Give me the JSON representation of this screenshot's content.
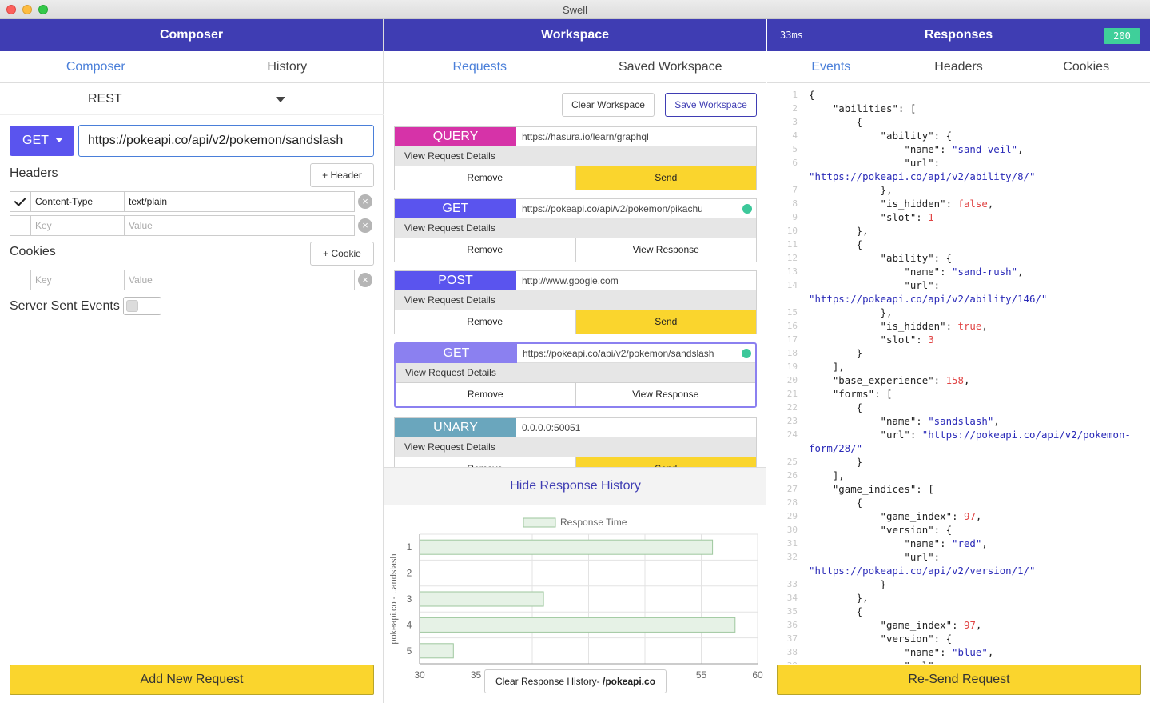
{
  "window": {
    "title": "Swell"
  },
  "composer": {
    "header": "Composer",
    "tabs": [
      "Composer",
      "History"
    ],
    "protocol": "REST",
    "method": "GET",
    "url": "https://pokeapi.co/api/v2/pokemon/sandslash",
    "headers_label": "Headers",
    "add_header": "+ Header",
    "headers": [
      {
        "key": "Content-Type",
        "value": "text/plain",
        "checked": true
      },
      {
        "key": "",
        "value": "",
        "checked": false
      }
    ],
    "key_placeholder": "Key",
    "value_placeholder": "Value",
    "cookies_label": "Cookies",
    "add_cookie": "+ Cookie",
    "sse_label": "Server Sent Events",
    "add_request": "Add New Request"
  },
  "workspace": {
    "header": "Workspace",
    "tabs": [
      "Requests",
      "Saved Workspace"
    ],
    "clear_btn": "Clear Workspace",
    "save_btn": "Save Workspace",
    "details_label": "View Request Details",
    "remove_label": "Remove",
    "requests": [
      {
        "method": "QUERY",
        "color": "#d633a8",
        "url": "https://hasura.io/learn/graphql",
        "action": "Send",
        "dot": false
      },
      {
        "method": "GET",
        "color": "#5a54ee",
        "url": "https://pokeapi.co/api/v2/pokemon/pikachu",
        "action": "View Response",
        "dot": true
      },
      {
        "method": "POST",
        "color": "#5a54ee",
        "url": "http://www.google.com",
        "action": "Send",
        "dot": false
      },
      {
        "method": "GET",
        "color": "#8b80f0",
        "url": "https://pokeapi.co/api/v2/pokemon/sandslash",
        "action": "View Response",
        "dot": true
      },
      {
        "method": "UNARY",
        "color": "#6aa6bd",
        "url": "0.0.0.0:50051",
        "action": "Send",
        "dot": false
      }
    ],
    "hide_history": "Hide Response History",
    "clear_history_prefix": "Clear Response History- ",
    "clear_history_host": "/pokeapi.co"
  },
  "chart_data": {
    "type": "bar",
    "orientation": "horizontal",
    "categories": [
      "1",
      "2",
      "3",
      "4",
      "5"
    ],
    "series": [
      {
        "name": "Response Time",
        "values": [
          56,
          30,
          41,
          58,
          33
        ]
      }
    ],
    "xlim": [
      30,
      60
    ],
    "xticks": [
      "30",
      "35",
      "40",
      "45",
      "50",
      "55",
      "60"
    ],
    "ylabel": "pokeapi.co - ..andslash",
    "legend": "top",
    "grid": true,
    "bar_fill": "#e6f2e6",
    "bar_stroke": "#9ec79e"
  },
  "responses": {
    "header": "Responses",
    "time": "33ms",
    "status": "200",
    "tabs": [
      "Events",
      "Headers",
      "Cookies"
    ],
    "resend": "Re-Send Request",
    "code_lines": [
      {
        "n": "1",
        "html": "{"
      },
      {
        "n": "2",
        "html": "    <span class='k'>\"abilities\"</span>: ["
      },
      {
        "n": "3",
        "html": "        {"
      },
      {
        "n": "4",
        "html": "            <span class='k'>\"ability\"</span>: {"
      },
      {
        "n": "5",
        "html": "                <span class='k'>\"name\"</span>: <span class='s'>\"sand-veil\"</span>,"
      },
      {
        "n": "6",
        "html": "                <span class='k'>\"url\"</span>:"
      },
      {
        "n": "",
        "html": "<span class='s'>\"https://pokeapi.co/api/v2/ability/8/\"</span>",
        "wrap": true
      },
      {
        "n": "7",
        "html": "            },"
      },
      {
        "n": "8",
        "html": "            <span class='k'>\"is_hidden\"</span>: <span class='b'>false</span>,"
      },
      {
        "n": "9",
        "html": "            <span class='k'>\"slot\"</span>: <span class='n'>1</span>"
      },
      {
        "n": "10",
        "html": "        },"
      },
      {
        "n": "11",
        "html": "        {"
      },
      {
        "n": "12",
        "html": "            <span class='k'>\"ability\"</span>: {"
      },
      {
        "n": "13",
        "html": "                <span class='k'>\"name\"</span>: <span class='s'>\"sand-rush\"</span>,"
      },
      {
        "n": "14",
        "html": "                <span class='k'>\"url\"</span>:"
      },
      {
        "n": "",
        "html": "<span class='s'>\"https://pokeapi.co/api/v2/ability/146/\"</span>",
        "wrap": true
      },
      {
        "n": "15",
        "html": "            },"
      },
      {
        "n": "16",
        "html": "            <span class='k'>\"is_hidden\"</span>: <span class='b'>true</span>,"
      },
      {
        "n": "17",
        "html": "            <span class='k'>\"slot\"</span>: <span class='n'>3</span>"
      },
      {
        "n": "18",
        "html": "        }"
      },
      {
        "n": "19",
        "html": "    ],"
      },
      {
        "n": "20",
        "html": "    <span class='k'>\"base_experience\"</span>: <span class='n'>158</span>,"
      },
      {
        "n": "21",
        "html": "    <span class='k'>\"forms\"</span>: ["
      },
      {
        "n": "22",
        "html": "        {"
      },
      {
        "n": "23",
        "html": "            <span class='k'>\"name\"</span>: <span class='s'>\"sandslash\"</span>,"
      },
      {
        "n": "24",
        "html": "            <span class='k'>\"url\"</span>: <span class='s'>\"https://pokeapi.co/api/v2/pokemon-</span>"
      },
      {
        "n": "",
        "html": "<span class='s'>form/28/\"</span>",
        "wrap": true
      },
      {
        "n": "25",
        "html": "        }"
      },
      {
        "n": "26",
        "html": "    ],"
      },
      {
        "n": "27",
        "html": "    <span class='k'>\"game_indices\"</span>: ["
      },
      {
        "n": "28",
        "html": "        {"
      },
      {
        "n": "29",
        "html": "            <span class='k'>\"game_index\"</span>: <span class='n'>97</span>,"
      },
      {
        "n": "30",
        "html": "            <span class='k'>\"version\"</span>: {"
      },
      {
        "n": "31",
        "html": "                <span class='k'>\"name\"</span>: <span class='s'>\"red\"</span>,"
      },
      {
        "n": "32",
        "html": "                <span class='k'>\"url\"</span>:"
      },
      {
        "n": "",
        "html": "<span class='s'>\"https://pokeapi.co/api/v2/version/1/\"</span>",
        "wrap": true
      },
      {
        "n": "33",
        "html": "            }"
      },
      {
        "n": "34",
        "html": "        },"
      },
      {
        "n": "35",
        "html": "        {"
      },
      {
        "n": "36",
        "html": "            <span class='k'>\"game_index\"</span>: <span class='n'>97</span>,"
      },
      {
        "n": "37",
        "html": "            <span class='k'>\"version\"</span>: {"
      },
      {
        "n": "38",
        "html": "                <span class='k'>\"name\"</span>: <span class='s'>\"blue\"</span>,"
      },
      {
        "n": "39",
        "html": "                <span class='k'>\"url\"</span>:"
      }
    ]
  }
}
